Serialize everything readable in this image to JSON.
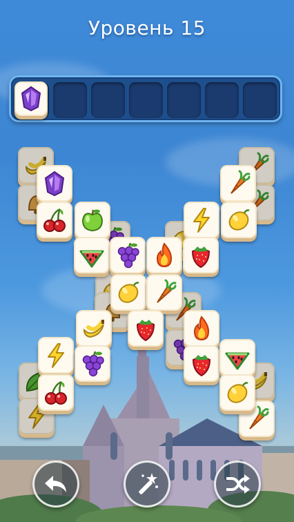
{
  "header": {
    "level_title": "Уровень 15"
  },
  "tray": {
    "slot_count": 7,
    "items": [
      "gem"
    ]
  },
  "board": {
    "tiles": [
      {
        "icon": "banana",
        "shade": true
      },
      {
        "icon": "carrot",
        "shade": true
      },
      {
        "icon": "gem",
        "shade": false
      },
      {
        "icon": "carrot",
        "shade": false
      },
      {
        "icon": "bell",
        "shade": true
      },
      {
        "icon": "carrot",
        "shade": true
      },
      {
        "icon": "cherry",
        "shade": false
      },
      {
        "icon": "apple",
        "shade": false
      },
      {
        "icon": "lightning",
        "shade": false
      },
      {
        "icon": "lemon",
        "shade": false
      },
      {
        "icon": "grape",
        "shade": true
      },
      {
        "icon": "lemon",
        "shade": true
      },
      {
        "icon": "watermelon",
        "shade": false
      },
      {
        "icon": "grape",
        "shade": false
      },
      {
        "icon": "fire",
        "shade": false
      },
      {
        "icon": "strawberry",
        "shade": false
      },
      {
        "icon": "lemon",
        "shade": true
      },
      {
        "icon": "lemon",
        "shade": false
      },
      {
        "icon": "carrot",
        "shade": false
      },
      {
        "icon": "bell",
        "shade": true
      },
      {
        "icon": "carrot",
        "shade": true
      },
      {
        "icon": "banana",
        "shade": false
      },
      {
        "icon": "strawberry",
        "shade": false
      },
      {
        "icon": "grape",
        "shade": true
      },
      {
        "icon": "fire",
        "shade": false
      },
      {
        "icon": "lightning",
        "shade": false
      },
      {
        "icon": "grape",
        "shade": false
      },
      {
        "icon": "strawberry",
        "shade": false
      },
      {
        "icon": "watermelon",
        "shade": false
      },
      {
        "icon": "leaf",
        "shade": true
      },
      {
        "icon": "cherry",
        "shade": false
      },
      {
        "icon": "banana",
        "shade": true
      },
      {
        "icon": "lemon",
        "shade": false
      },
      {
        "icon": "lightning",
        "shade": true
      },
      {
        "icon": "carrot",
        "shade": false
      }
    ]
  },
  "controls": [
    {
      "name": "undo-button",
      "icon": "undo-arrow-icon"
    },
    {
      "name": "magic-wand-button",
      "icon": "magic-wand-icon"
    },
    {
      "name": "shuffle-button",
      "icon": "shuffle-icon"
    }
  ]
}
